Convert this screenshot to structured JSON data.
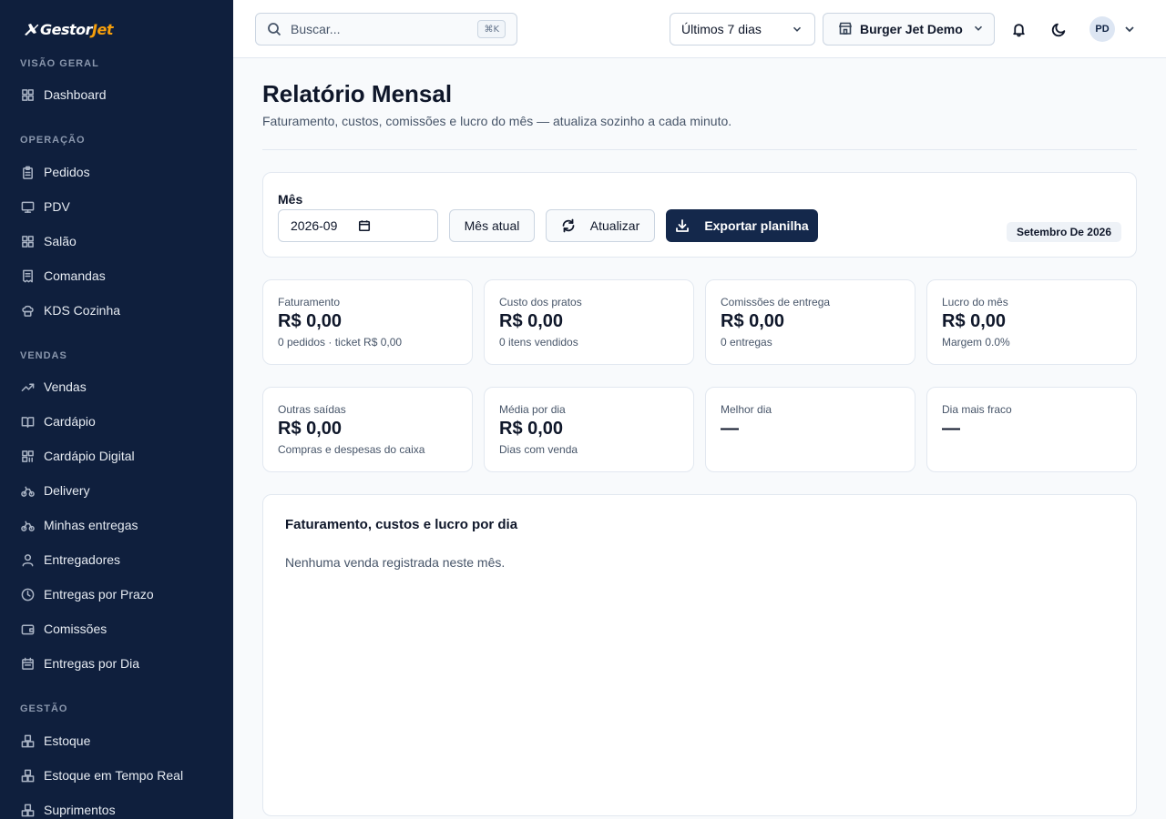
{
  "app": {
    "logo_text_main": "Gestor",
    "logo_text_accent": "Jet"
  },
  "sidebar": {
    "sections": [
      {
        "title": "VISÃO GERAL",
        "items": [
          {
            "label": "Dashboard",
            "icon": "grid-icon"
          }
        ]
      },
      {
        "title": "OPERAÇÃO",
        "items": [
          {
            "label": "Pedidos",
            "icon": "clipboard-icon"
          },
          {
            "label": "PDV",
            "icon": "monitor-icon"
          },
          {
            "label": "Salão",
            "icon": "grid-icon"
          },
          {
            "label": "Comandas",
            "icon": "receipt-icon"
          },
          {
            "label": "KDS Cozinha",
            "icon": "chef-hat-icon"
          }
        ]
      },
      {
        "title": "VENDAS",
        "items": [
          {
            "label": "Vendas",
            "icon": "trending-up-icon"
          },
          {
            "label": "Cardápio",
            "icon": "book-icon"
          },
          {
            "label": "Cardápio Digital",
            "icon": "qr-code-icon"
          },
          {
            "label": "Delivery",
            "icon": "bike-icon"
          },
          {
            "label": "Minhas entregas",
            "icon": "bike-icon"
          },
          {
            "label": "Entregadores",
            "icon": "user-icon"
          },
          {
            "label": "Entregas por Prazo",
            "icon": "clock-icon"
          },
          {
            "label": "Comissões",
            "icon": "wallet-icon"
          },
          {
            "label": "Entregas por Dia",
            "icon": "calendar-icon"
          }
        ]
      },
      {
        "title": "GESTÃO",
        "items": [
          {
            "label": "Estoque",
            "icon": "boxes-icon"
          },
          {
            "label": "Estoque em Tempo Real",
            "icon": "boxes-icon"
          },
          {
            "label": "Suprimentos",
            "icon": "boxes-icon"
          }
        ]
      }
    ]
  },
  "topbar": {
    "search_placeholder": "Buscar...",
    "search_shortcut": "⌘K",
    "period_value": "Últimos 7 dias",
    "store_value": "Burger Jet Demo",
    "avatar_initials": "PD"
  },
  "page": {
    "title": "Relatório Mensal",
    "subtitle": "Faturamento, custos, comissões e lucro do mês — atualiza sozinho a cada minuto."
  },
  "month_filter": {
    "label": "Mês",
    "value": "2026-09",
    "current_button": "Mês atual",
    "refresh_button": "Atualizar",
    "export_button": "Exportar planilha",
    "badge": "Setembro De 2026"
  },
  "kpis": [
    {
      "label": "Faturamento",
      "value": "R$ 0,00",
      "sub": "0 pedidos · ticket R$ 0,00"
    },
    {
      "label": "Custo dos pratos",
      "value": "R$ 0,00",
      "sub": "0 itens vendidos"
    },
    {
      "label": "Comissões de entrega",
      "value": "R$ 0,00",
      "sub": "0 entregas"
    },
    {
      "label": "Lucro do mês",
      "value": "R$ 0,00",
      "sub": "Margem 0.0%"
    },
    {
      "label": "Outras saídas",
      "value": "R$ 0,00",
      "sub": "Compras e despesas do caixa"
    },
    {
      "label": "Média por dia",
      "value": "R$ 0,00",
      "sub": "Dias com venda"
    },
    {
      "label": "Melhor dia",
      "value": "—",
      "sub": ""
    },
    {
      "label": "Dia mais fraco",
      "value": "—",
      "sub": ""
    }
  ],
  "chart": {
    "title": "Faturamento, custos e lucro por dia",
    "empty_message": "Nenhuma venda registrada neste mês."
  },
  "colors": {
    "sidebar_bg": "#0f1f3d",
    "primary_button": "#14284b",
    "logo_accent": "#f59e0b"
  }
}
